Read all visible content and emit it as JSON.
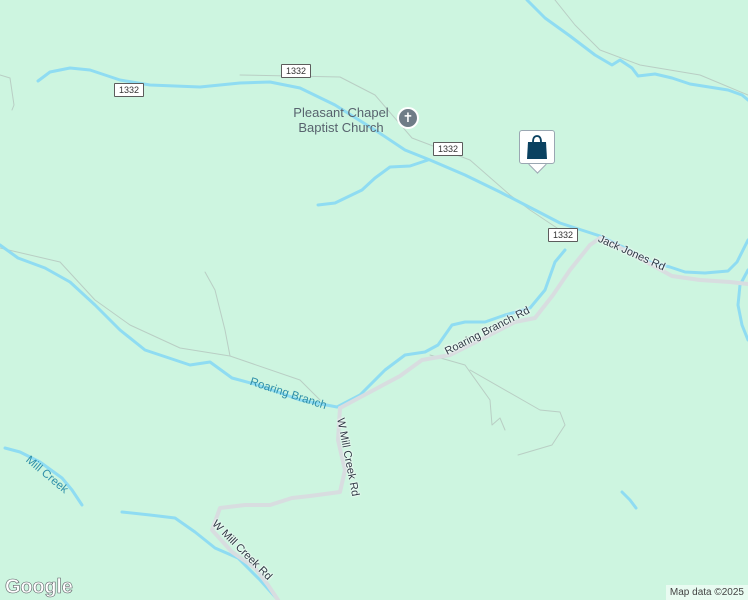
{
  "map": {
    "attribution": "Map data ©2025",
    "logo": "Google",
    "colors": {
      "land": "#cdf5e0",
      "water": "#8fdcf2",
      "road": "#d8dde0",
      "marker_accent": "#0a4160"
    }
  },
  "route_shields": [
    "1332",
    "1332",
    "1332",
    "1332"
  ],
  "roads": {
    "jack_jones": "Jack Jones Rd",
    "roaring_branch_rd": "Roaring Branch Rd",
    "w_mill_creek_1": "W Mill Creek Rd",
    "w_mill_creek_2": "W Mill Creek Rd"
  },
  "waterways": {
    "roaring_branch": "Roaring Branch",
    "mill_creek": "Mill Creek"
  },
  "poi": {
    "name_line1": "Pleasant Chapel",
    "name_line2": "Baptist Church",
    "icon": "church-icon"
  },
  "marker": {
    "icon": "shopping-bag-icon"
  }
}
